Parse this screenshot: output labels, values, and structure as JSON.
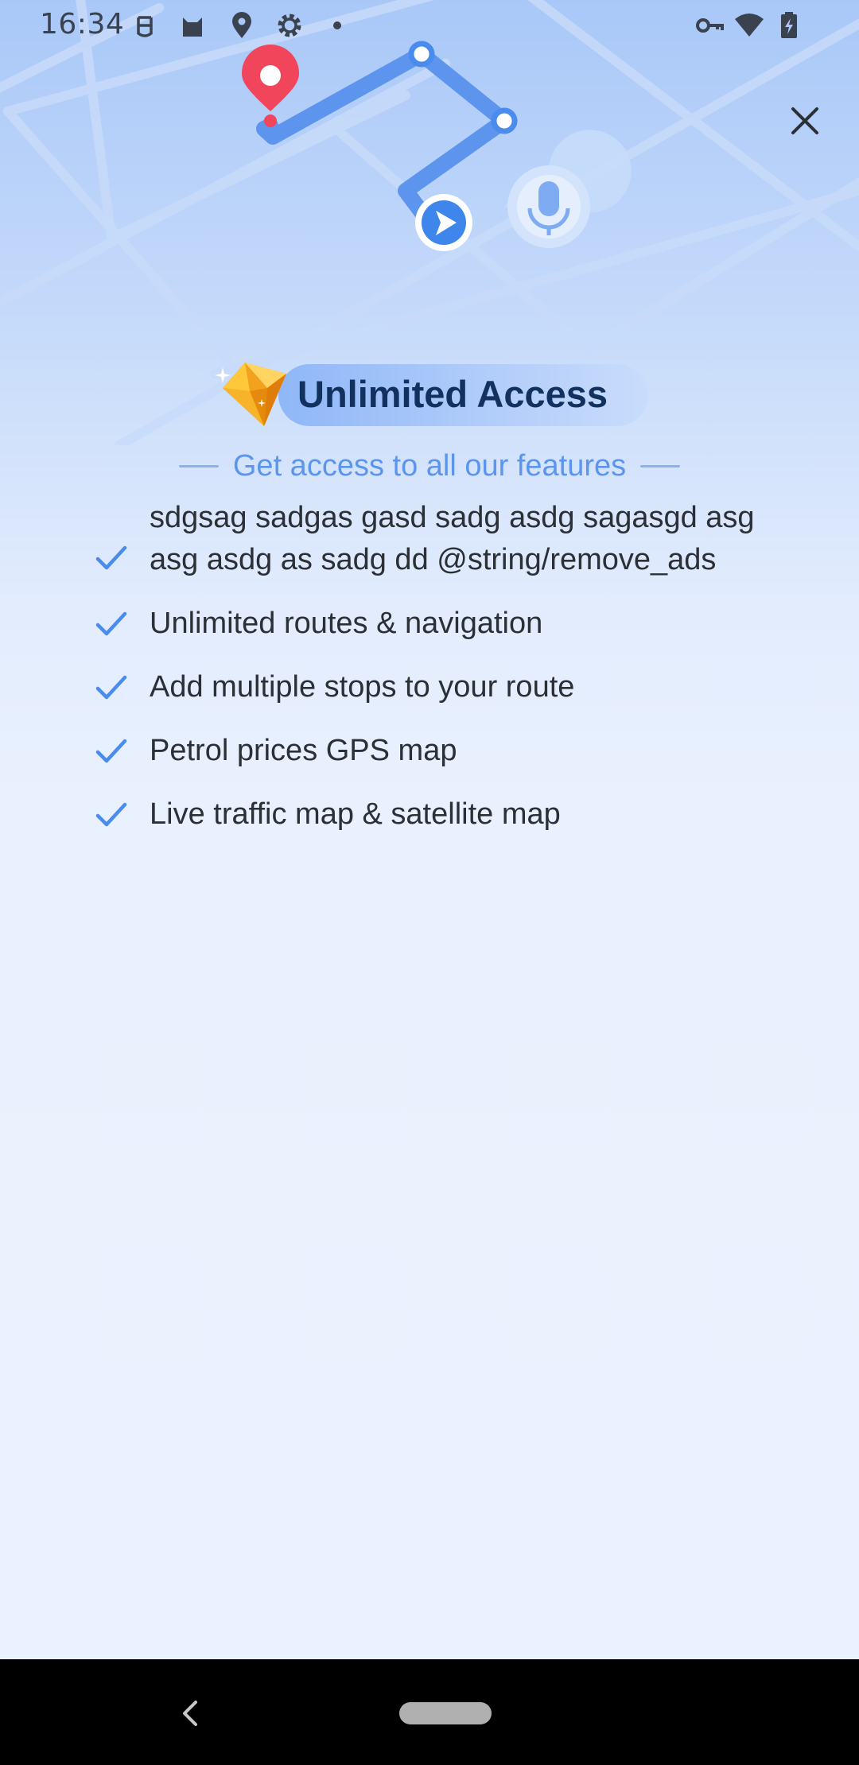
{
  "status_bar": {
    "time": "16:34",
    "left_icons": [
      "android-debug-icon",
      "cat-icon",
      "location-icon",
      "settings-icon",
      "dot-icon"
    ],
    "right_icons": [
      "vpn-key-icon",
      "wifi-icon",
      "battery-charging-icon"
    ]
  },
  "header": {
    "close_icon": "close-icon"
  },
  "promo": {
    "title": "Unlimited Access",
    "subtitle": "Get access to all our features",
    "features": [
      "sdgsag sadgas gasd sadg asdg sagasgd asg asg asdg as sadg dd @string/remove_ads",
      "Unlimited routes & navigation",
      "Add multiple stops to your route",
      "Petrol prices GPS map",
      "Live traffic map & satellite map"
    ]
  },
  "colors": {
    "accent": "#4A8BEE",
    "pin": "#F0455A",
    "title_text": "#13315F",
    "subtitle_text": "#5B95EE"
  }
}
